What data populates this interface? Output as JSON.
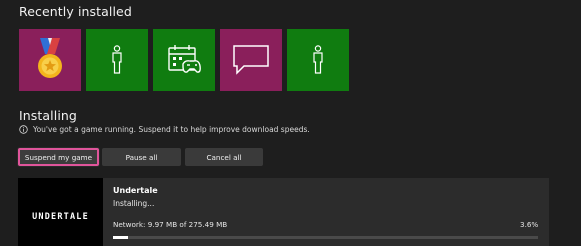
{
  "recently_installed": {
    "title": "Recently installed",
    "tiles": [
      {
        "icon": "medal-icon",
        "color": "#8a1f5b"
      },
      {
        "icon": "person-icon",
        "color": "#107c10"
      },
      {
        "icon": "calendar-controller-icon",
        "color": "#107c10"
      },
      {
        "icon": "chat-bubble-icon",
        "color": "#8a1f5b"
      },
      {
        "icon": "person-icon",
        "color": "#107c10"
      }
    ]
  },
  "installing": {
    "title": "Installing",
    "notice": "You've got a game running. Suspend it to help improve download speeds.",
    "buttons": {
      "suspend": "Suspend my game",
      "pause_all": "Pause all",
      "cancel_all": "Cancel all"
    },
    "items": [
      {
        "logo_text": "UNDERTALE",
        "name": "Undertale",
        "status": "Installing...",
        "network": "Network: 9.97 MB of 275.49 MB",
        "percent_label": "3.6%",
        "progress": 0.036
      }
    ]
  },
  "colors": {
    "background": "#1e1e1e",
    "accent_focus": "#e0559b",
    "green_tile": "#107c10",
    "magenta_tile": "#8a1f5b"
  }
}
